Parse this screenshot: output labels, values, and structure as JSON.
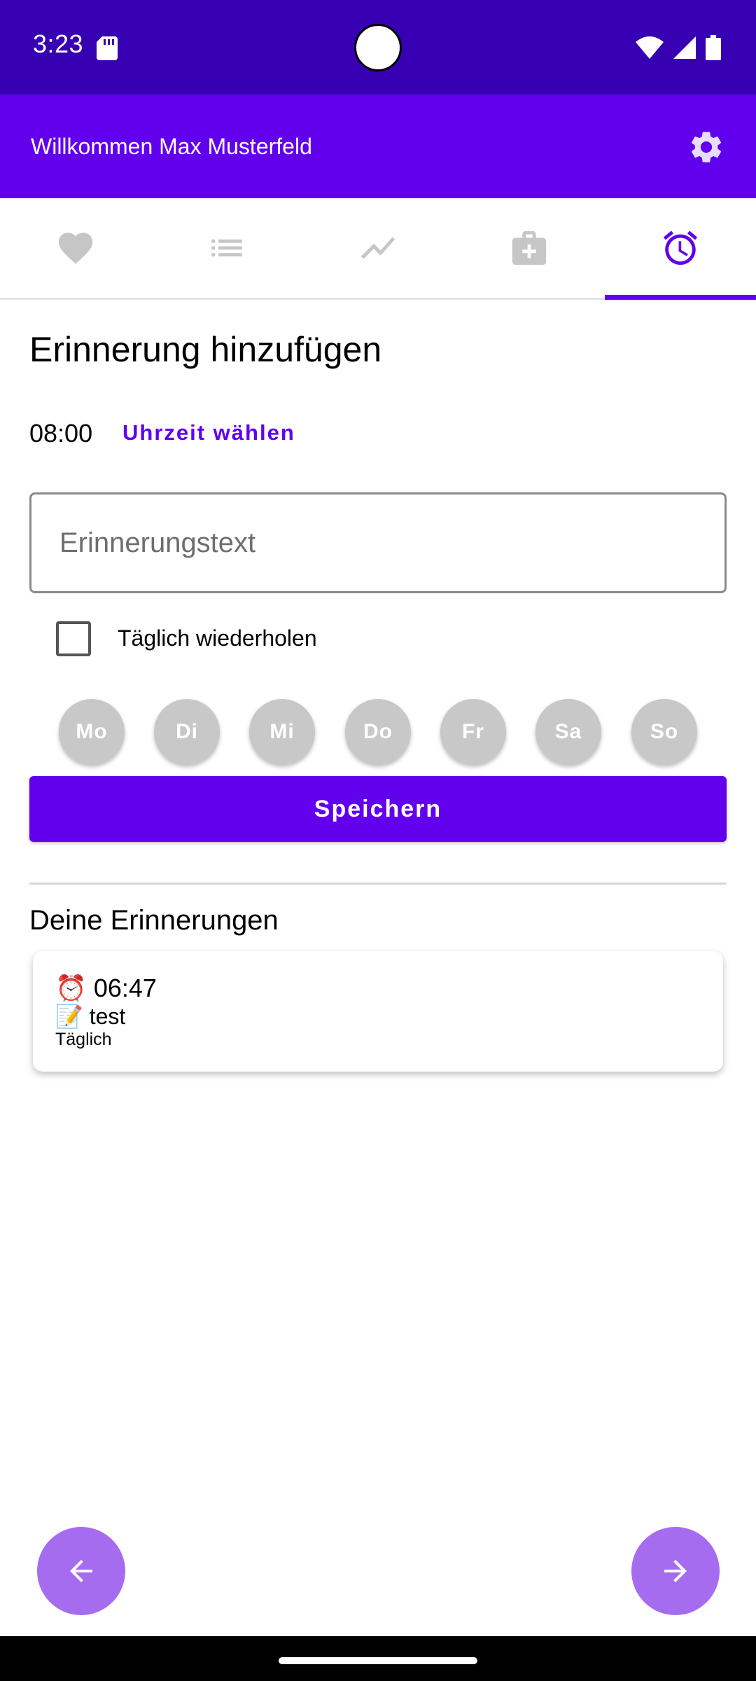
{
  "status_bar": {
    "time": "3:23"
  },
  "app_bar": {
    "title": "Willkommen Max Musterfeld"
  },
  "tabs": [
    {
      "icon": "heart-icon",
      "active": false
    },
    {
      "icon": "list-icon",
      "active": false
    },
    {
      "icon": "trending-icon",
      "active": false
    },
    {
      "icon": "medical-bag-icon",
      "active": false
    },
    {
      "icon": "alarm-icon",
      "active": true
    }
  ],
  "form": {
    "heading": "Erinnerung hinzufügen",
    "time": "08:00",
    "choose_time_label": "Uhrzeit wählen",
    "text_placeholder": "Erinnerungstext",
    "text_value": "",
    "repeat_daily_label": "Täglich wiederholen",
    "repeat_daily_checked": false,
    "days": [
      "Mo",
      "Di",
      "Mi",
      "Do",
      "Fr",
      "Sa",
      "So"
    ],
    "save_label": "Speichern"
  },
  "reminders": {
    "heading": "Deine Erinnerungen",
    "items": [
      {
        "time": "⏰ 06:47",
        "text": "📝 test",
        "repeat": "Täglich"
      }
    ]
  },
  "colors": {
    "status_bar": "#3700b3",
    "primary": "#6200ee",
    "fab": "#a66cf0",
    "day_inactive": "#c8c8c8"
  }
}
